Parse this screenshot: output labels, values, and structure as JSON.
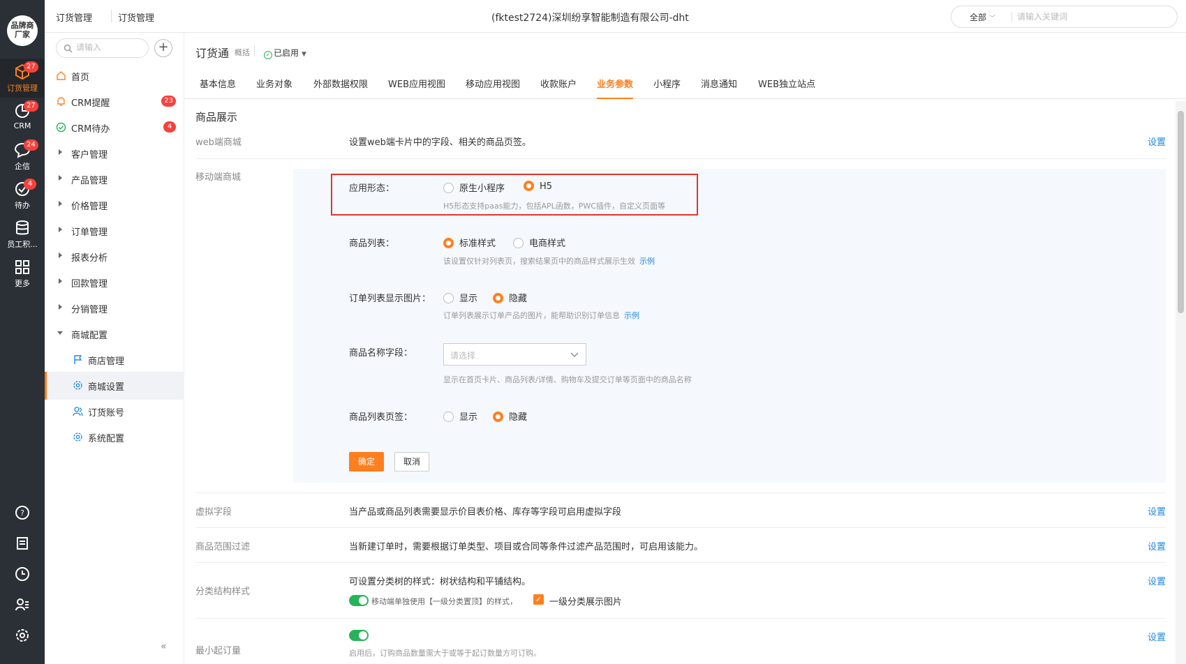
{
  "rail": {
    "logo": "品牌商\n厂家",
    "items": [
      {
        "label": "订货管理",
        "badge": "27",
        "icon": "box-icon"
      },
      {
        "label": "CRM",
        "badge": "27",
        "icon": "pie-chart-icon"
      },
      {
        "label": "企信",
        "badge": "24",
        "icon": "chat-bubble-icon"
      },
      {
        "label": "待办",
        "badge": "4",
        "icon": "check-circle-icon"
      },
      {
        "label": "员工积...",
        "badge": "",
        "icon": "database-icon"
      },
      {
        "label": "更多",
        "badge": "",
        "icon": "grid-icon"
      }
    ]
  },
  "header": {
    "crumb1": "订货管理",
    "crumb2": "订货管理",
    "company": "(fktest2724)深圳纷享智能制造有限公司-dht",
    "search_scope": "全部",
    "search_placeholder": "请输入关键词"
  },
  "sidebar": {
    "search_placeholder": "请输入",
    "add_label": "+",
    "items": [
      {
        "label": "首页",
        "badge": ""
      },
      {
        "label": "CRM提醒",
        "badge": "23"
      },
      {
        "label": "CRM待办",
        "badge": "4"
      },
      {
        "label": "客户管理",
        "badge": ""
      },
      {
        "label": "产品管理",
        "badge": ""
      },
      {
        "label": "价格管理",
        "badge": ""
      },
      {
        "label": "订单管理",
        "badge": ""
      },
      {
        "label": "报表分析",
        "badge": ""
      },
      {
        "label": "回款管理",
        "badge": ""
      },
      {
        "label": "分销管理",
        "badge": ""
      },
      {
        "label": "商城配置",
        "badge": ""
      }
    ],
    "subitems": [
      {
        "label": "商店管理"
      },
      {
        "label": "商城设置"
      },
      {
        "label": "订货账号"
      },
      {
        "label": "系统配置"
      }
    ],
    "collapse": "«"
  },
  "app": {
    "title": "订货通",
    "subtitle": "概括",
    "status": "已启用"
  },
  "tabs": [
    "基本信息",
    "业务对象",
    "外部数据权限",
    "WEB应用视图",
    "移动应用视图",
    "收款账户",
    "业务参数",
    "小程序",
    "消息通知",
    "WEB独立站点"
  ],
  "content": {
    "section_title": "商品展示",
    "web_mall": {
      "label": "web端商城",
      "desc": "设置web端卡片中的字段、相关的商品页签。",
      "link": "设置"
    },
    "mobile_mall": {
      "label": "移动端商城",
      "app_form": {
        "label": "应用形态：",
        "opt1": "原生小程序",
        "opt2": "H5",
        "hint": "H5形态支持paas能力，包括APL函数，PWC插件，自定义页面等"
      },
      "product_list": {
        "label": "商品列表：",
        "opt1": "标准样式",
        "opt2": "电商样式",
        "hint": "该设置仅针对列表页，搜索结果页中的商品样式展示生效",
        "link": "示例"
      },
      "order_img": {
        "label": "订单列表显示图片：",
        "opt1": "显示",
        "opt2": "隐藏",
        "hint": "订单列表展示订单产品的图片，能帮助识别订单信息",
        "link": "示例"
      },
      "name_field": {
        "label": "商品名称字段：",
        "placeholder": "请选择",
        "hint": "显示在首页卡片、商品列表/详情、购物车及提交订单等页面中的商品名称"
      },
      "list_tab": {
        "label": "商品列表页签：",
        "opt1": "显示",
        "opt2": "隐藏"
      },
      "ok": "确定",
      "cancel": "取消"
    },
    "virtual_field": {
      "label": "虚拟字段",
      "desc": "当产品或商品列表需要显示价目表价格、库存等字段可启用虚拟字段",
      "link": "设置"
    },
    "range_filter": {
      "label": "商品范围过滤",
      "desc": "当新建订单时，需要根据订单类型、项目或合同等条件过滤产品范围时，可启用该能力。",
      "link": "设置"
    },
    "category_style": {
      "label": "分类结构样式",
      "desc": "可设置分类树的样式：树状结构和平铺结构。",
      "toggle_text": "移动端单独使用【一级分类置顶】的样式，",
      "check_text": "一级分类展示图片",
      "link": "设置"
    },
    "min_order": {
      "label": "最小起订量",
      "desc": "启用后，订购商品数量需大于或等于起订数量方可订购。",
      "link": "设置"
    }
  },
  "colors": {
    "accent": "#ff7f1f",
    "link": "#1e88e5",
    "danger": "#e5332a",
    "success": "#27b35a",
    "rail": "#2b3036"
  }
}
